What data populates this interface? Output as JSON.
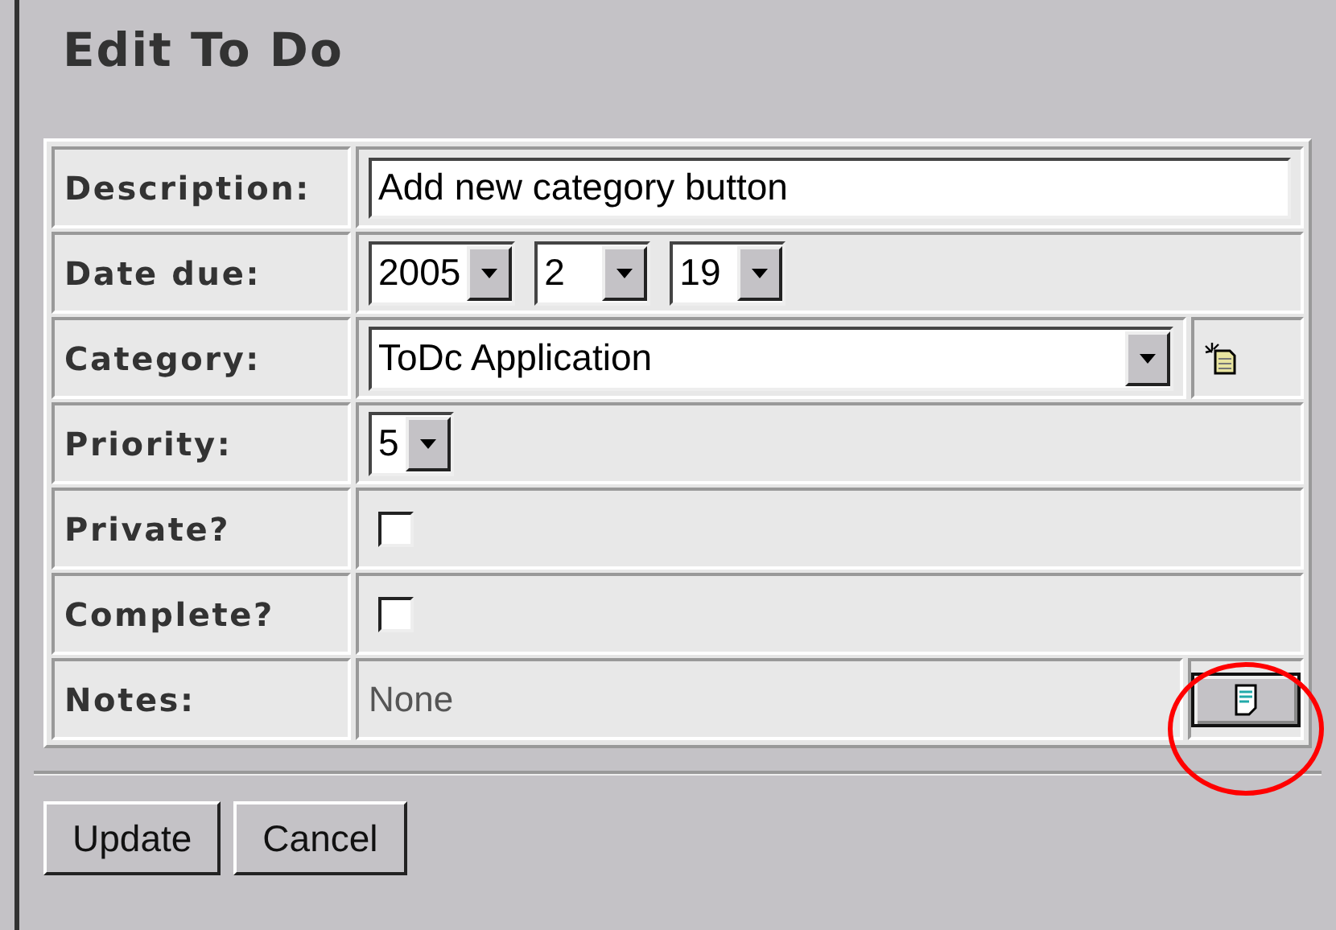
{
  "title": "Edit To Do",
  "rows": [
    {
      "kind": "text",
      "label": "Description:",
      "value": "Add new category button"
    },
    {
      "kind": "date",
      "label": "Date due:",
      "selects": [
        "2005",
        "2",
        "19"
      ]
    },
    {
      "kind": "select",
      "label": "Category:",
      "value": "ToDc Application"
    },
    {
      "kind": "priority",
      "label": "Priority:",
      "value": "5"
    },
    {
      "kind": "checkbox",
      "label": "Private?",
      "checked": false
    },
    {
      "kind": "checkbox",
      "label": "Complete?",
      "checked": false
    },
    {
      "kind": "notes",
      "label": "Notes:",
      "value": "None",
      "highlighted": true
    }
  ],
  "buttons": [
    "Update",
    "Cancel"
  ]
}
